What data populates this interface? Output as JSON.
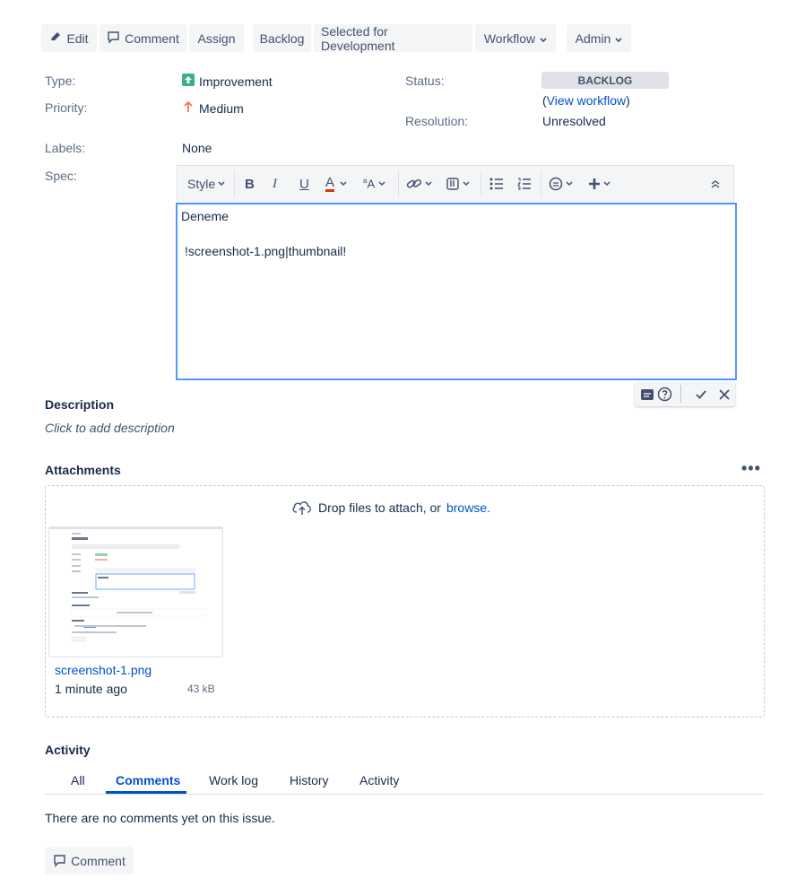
{
  "toolbar": {
    "edit_label": "Edit",
    "comment_label": "Comment",
    "assign_label": "Assign",
    "backlog_label": "Backlog",
    "selected_label": "Selected for Development",
    "workflow_label": "Workflow",
    "admin_label": "Admin"
  },
  "fields": {
    "type_label": "Type:",
    "type_value": "Improvement",
    "priority_label": "Priority:",
    "priority_value": "Medium",
    "labels_label": "Labels:",
    "labels_value": "None",
    "spec_label": "Spec:",
    "status_label": "Status:",
    "status_value": "BACKLOG",
    "view_workflow_open": "(",
    "view_workflow_link": "View workflow",
    "view_workflow_close": ")",
    "resolution_label": "Resolution:",
    "resolution_value": "Unresolved"
  },
  "editor": {
    "style_label": "Style",
    "line1": "Deneme",
    "line2": "!screenshot-1.png|thumbnail!"
  },
  "description": {
    "heading": "Description",
    "placeholder": "Click to add description"
  },
  "attachments": {
    "heading": "Attachments",
    "drop_text": "Drop files to attach, or",
    "browse_link": "browse.",
    "file": {
      "name": "screenshot-1.png",
      "time": "1 minute ago",
      "size": "43 kB"
    }
  },
  "activity": {
    "heading": "Activity",
    "tabs": [
      "All",
      "Comments",
      "Work log",
      "History",
      "Activity"
    ],
    "active_tab": "Comments",
    "empty_text": "There are no comments yet on this issue.",
    "comment_button": "Comment"
  },
  "colors": {
    "accent": "#0052cc",
    "editor_border": "#4c9aff",
    "improvement_green": "#36b37e",
    "priority_orange": "#ff7452",
    "status_bg": "#dfe1e6",
    "underline_red": "#de350b"
  }
}
